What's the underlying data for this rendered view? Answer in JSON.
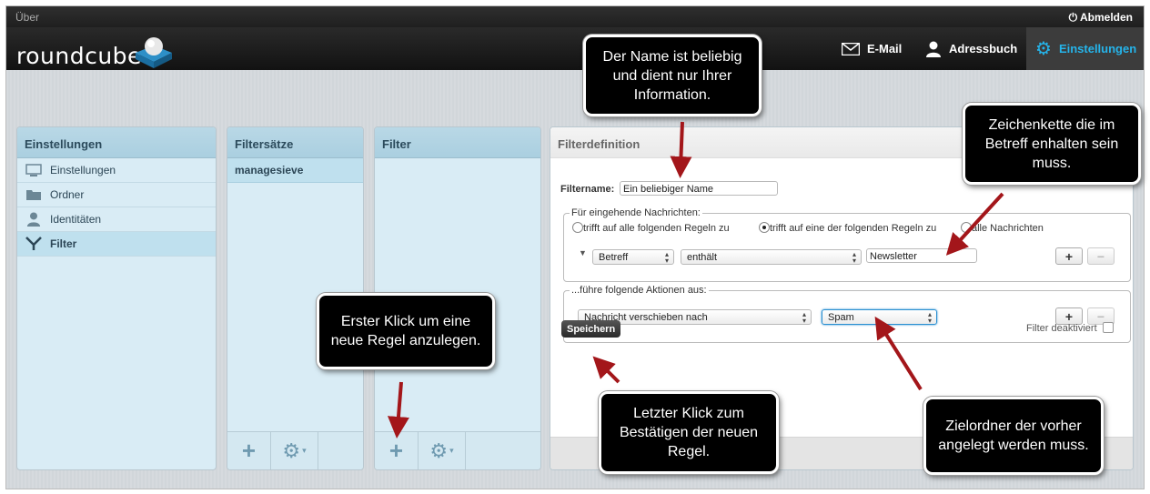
{
  "topbar": {
    "about": "Über",
    "logout": "Abmelden"
  },
  "header": {
    "logo": "roundcube",
    "nav": [
      {
        "label": "E-Mail",
        "icon": "envelope-icon"
      },
      {
        "label": "Adressbuch",
        "icon": "person-icon"
      },
      {
        "label": "Einstellungen",
        "icon": "gear-icon"
      }
    ]
  },
  "settings_panel": {
    "title": "Einstellungen",
    "items": [
      {
        "label": "Einstellungen",
        "icon": "monitor-icon"
      },
      {
        "label": "Ordner",
        "icon": "folder-icon"
      },
      {
        "label": "Identitäten",
        "icon": "person-icon"
      },
      {
        "label": "Filter",
        "icon": "filter-icon"
      }
    ]
  },
  "filtersets_panel": {
    "title": "Filtersätze",
    "items": [
      "managesieve"
    ]
  },
  "filter_panel": {
    "title": "Filter"
  },
  "definition": {
    "title": "Filterdefinition",
    "name_label": "Filtername:",
    "name_value": "Ein beliebiger Name",
    "incoming_legend": "Für eingehende Nachrichten:",
    "radio_all": "trifft auf alle folgenden Regeln zu",
    "radio_any": "trifft auf eine der folgenden Regeln zu",
    "radio_all_msgs": "alle Nachrichten",
    "rule_header": "Betreff",
    "rule_op": "enthält",
    "rule_value": "Newsletter",
    "actions_legend": "...führe folgende Aktionen aus:",
    "action": "Nachricht verschieben nach",
    "action_target": "Spam",
    "save_label": "Speichern",
    "disable_label": "Filter deaktiviert",
    "add_label": "+",
    "remove_label": "−"
  },
  "panel_buttons": {
    "add": "+",
    "gear": "⚙",
    "caret": "▾"
  },
  "callouts": {
    "name": "Der Name ist beliebig und dient nur Ihrer Information.",
    "subject": "Zeichenkette die im Betreff enhalten sein muss.",
    "first_click": "Erster Klick um eine neue Regel anzulegen.",
    "last_click": "Letzter Klick zum Bestätigen der neuen Regel.",
    "target_folder": "Zielordner der vorher angelegt werden muss."
  },
  "colors": {
    "accent": "#25b4ea",
    "arrow": "#a3161a"
  }
}
